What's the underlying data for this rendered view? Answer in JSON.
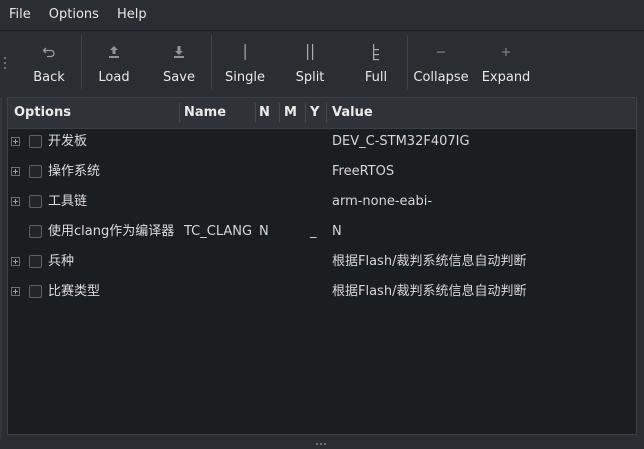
{
  "menu": [
    "File",
    "Options",
    "Help"
  ],
  "toolbar": {
    "back": "Back",
    "load": "Load",
    "save": "Save",
    "single": "Single",
    "split": "Split",
    "full": "Full",
    "collapse": "Collapse",
    "expand": "Expand"
  },
  "columns": {
    "options": "Options",
    "name": "Name",
    "n": "N",
    "m": "M",
    "y": "Y",
    "value": "Value"
  },
  "rows": [
    {
      "label": "开发板",
      "name": "",
      "n": "",
      "m": "",
      "y": "",
      "value": "DEV_C-STM32F407IG",
      "expandable": true
    },
    {
      "label": "操作系统",
      "name": "",
      "n": "",
      "m": "",
      "y": "",
      "value": "FreeRTOS",
      "expandable": true
    },
    {
      "label": "工具链",
      "name": "",
      "n": "",
      "m": "",
      "y": "",
      "value": "arm-none-eabi-",
      "expandable": true
    },
    {
      "label": "使用clang作为编译器",
      "name": "TC_CLANG",
      "n": "N",
      "m": "",
      "y": "_",
      "value": "N",
      "expandable": false
    },
    {
      "label": "兵种",
      "name": "",
      "n": "",
      "m": "",
      "y": "",
      "value": "根据Flash/裁判系统信息自动判断",
      "expandable": true
    },
    {
      "label": "比赛类型",
      "name": "",
      "n": "",
      "m": "",
      "y": "",
      "value": "根据Flash/裁判系统信息自动判断",
      "expandable": true
    }
  ],
  "colors": {
    "background": "#2a2e32",
    "tree_background": "#1b1e20",
    "header_background": "#2f3337",
    "text": "#e0e0e0"
  },
  "icons": {
    "back": "undo-arrow-icon",
    "load": "upload-arrow-icon",
    "save": "download-arrow-icon",
    "single": "single-bar-icon",
    "split": "double-bar-icon",
    "full": "tree-bar-icon",
    "collapse": "minus-icon",
    "expand": "plus-icon"
  }
}
